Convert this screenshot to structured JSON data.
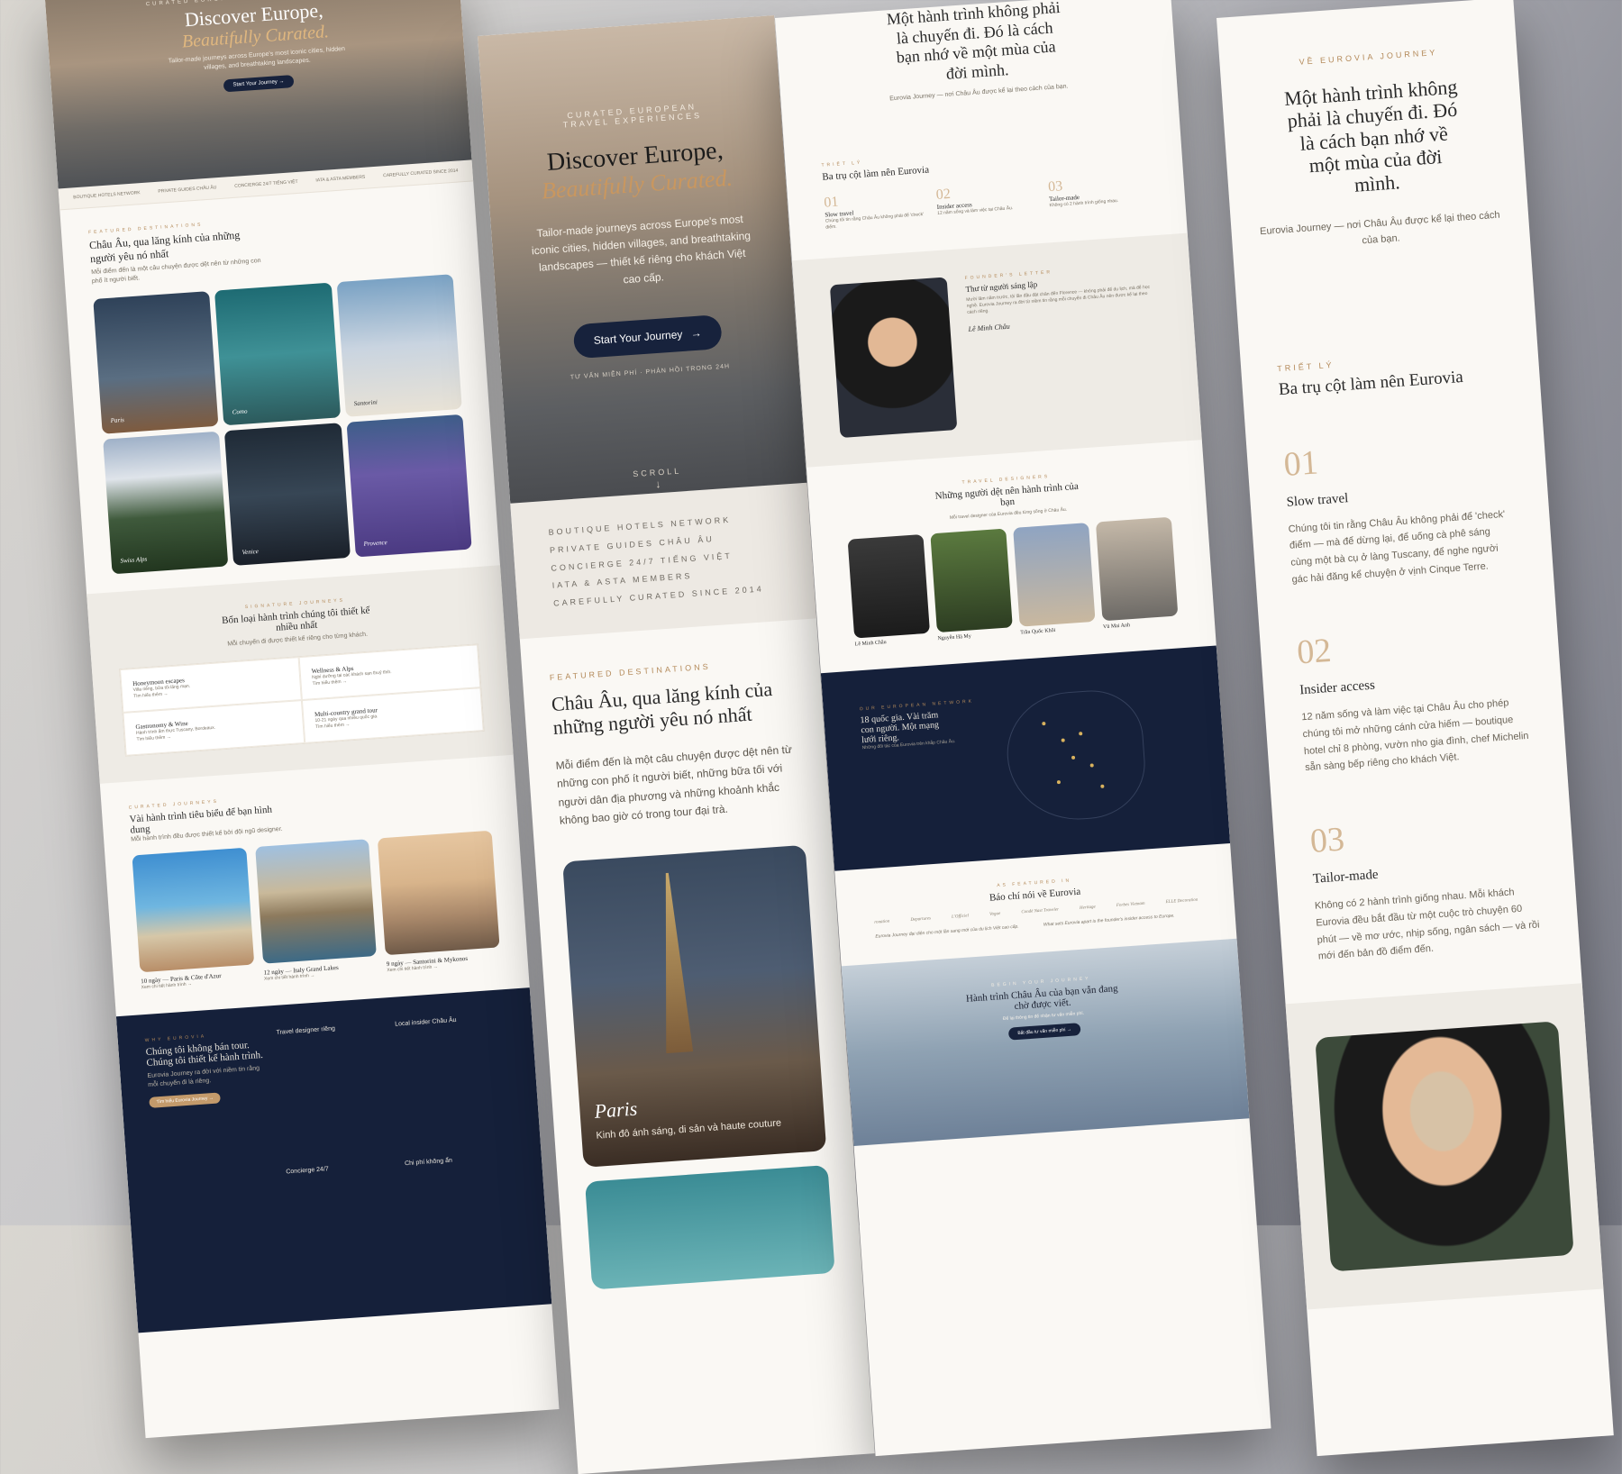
{
  "s1": {
    "hero_eyebrow": "CURATED EUROPEAN TRAVEL EXPERIENCES",
    "hero_title": "Discover Europe,",
    "hero_title_accent": "Beautifully Curated.",
    "hero_text": "Tailor-made journeys across Europe's most iconic cities, hidden villages, and breathtaking landscapes.",
    "hero_cta": "Start Your Journey →",
    "trust": [
      "BOUTIQUE HOTELS NETWORK",
      "PRIVATE GUIDES CHÂU ÂU",
      "CONCIERGE 24/7 TIẾNG VIỆT",
      "IATA & ASTA MEMBERS",
      "CAREFULLY CURATED SINCE 2014"
    ],
    "featured_eyebrow": "FEATURED DESTINATIONS",
    "featured_title": "Châu Âu, qua lăng kính của những người yêu nó nhất",
    "featured_text": "Mỗi điểm đến là một câu chuyện được dệt nên từ những con phố ít người biết.",
    "destinations": [
      "Paris",
      "Como",
      "Santorini",
      "Swiss Alps",
      "Venice",
      "Provence"
    ],
    "types_eyebrow": "SIGNATURE JOURNEYS",
    "types_title": "Bốn loại hành trình chúng tôi thiết kế nhiều nhất",
    "types_text": "Mỗi chuyến đi được thiết kế riêng cho từng khách.",
    "types": [
      {
        "title": "Honeymoon escapes",
        "desc": "Villa riêng, bữa tối lãng mạn.",
        "link": "Tìm hiểu thêm →"
      },
      {
        "title": "Wellness & Alps",
        "desc": "Nghỉ dưỡng tại các khách sạn thuỷ tĩnh.",
        "link": "Tìm hiểu thêm →"
      },
      {
        "title": "Gastronomy & Wine",
        "desc": "Hành trình ẩm thực Tuscany, Bordeaux.",
        "link": "Tìm hiểu thêm →"
      },
      {
        "title": "Multi-country grand tour",
        "desc": "10-21 ngày qua nhiều quốc gia.",
        "link": "Tìm hiểu thêm →"
      }
    ],
    "curated_eyebrow": "CURATED JOURNEYS",
    "curated_title": "Vài hành trình tiêu biểu để bạn hình dung",
    "curated_text": "Mỗi hành trình đều được thiết kế bởi đội ngũ designer.",
    "journeys": [
      {
        "title": "10 ngày — Paris & Côte d'Azur",
        "link": "Xem chi tiết hành trình →"
      },
      {
        "title": "12 ngày — Italy Grand Lakes",
        "link": "Xem chi tiết hành trình →"
      },
      {
        "title": "9 ngày — Santorini & Mykonos",
        "link": "Xem chi tiết hành trình →"
      }
    ],
    "why_eyebrow": "WHY EUROVIA",
    "why_title": "Chúng tôi không bán tour. Chúng tôi thiết kế hành trình.",
    "why_text": "Eurovia Journey ra đời với niềm tin rằng mỗi chuyến đi là riêng.",
    "why_cta": "Tìm hiểu Eurovia Journey →",
    "why_items": [
      "Travel designer riêng",
      "Local insider Châu Âu",
      "Concierge 24/7",
      "Chi phí không ẩn"
    ]
  },
  "s2": {
    "eyebrow": "CURATED EUROPEAN TRAVEL EXPERIENCES",
    "title": "Discover Europe,",
    "title_accent": "Beautifully Curated.",
    "text": "Tailor-made journeys across Europe's most iconic cities, hidden villages, and breathtaking landscapes — thiết kế riêng cho khách Việt cao cấp.",
    "cta": "Start Your Journey",
    "cta_arrow": "→",
    "note": "TƯ VẤN MIỄN PHÍ · PHẢN HỒI TRONG 24H",
    "scroll": "SCROLL",
    "scroll_arrow": "↓",
    "trust": [
      "BOUTIQUE HOTELS NETWORK",
      "PRIVATE GUIDES CHÂU ÂU",
      "CONCIERGE 24/7 TIẾNG VIỆT",
      "IATA & ASTA MEMBERS",
      "CAREFULLY CURATED SINCE 2014"
    ],
    "featured_eyebrow": "FEATURED DESTINATIONS",
    "featured_title": "Châu Âu, qua lăng kính của những người yêu nó nhất",
    "featured_text": "Mỗi điểm đến là một câu chuyện được dệt nên từ những con phố ít người biết, những bữa tối với người dân địa phương và những khoảnh khắc không bao giờ có trong tour đại trà.",
    "card_title": "Paris",
    "card_sub": "Kinh đô ánh sáng, di sản và haute couture"
  },
  "s3": {
    "quote": "Một hành trình không phải là chuyến đi. Đó là cách bạn nhớ về một mùa của đời mình.",
    "quote_sub": "Eurovia Journey — nơi Châu Âu được kể lại theo cách của bạn.",
    "pillars_eyebrow": "TRIẾT LÝ",
    "pillars_title": "Ba trụ cột làm nên Eurovia",
    "pillars": [
      {
        "num": "01",
        "title": "Slow travel",
        "desc": "Chúng tôi tin rằng Châu Âu không phải để 'check' điểm."
      },
      {
        "num": "02",
        "title": "Insider access",
        "desc": "12 năm sống và làm việc tại Châu Âu."
      },
      {
        "num": "03",
        "title": "Tailor-made",
        "desc": "Không có 2 hành trình giống nhau."
      }
    ],
    "letter_eyebrow": "FOUNDER'S LETTER",
    "letter_title": "Thư từ người sáng lập",
    "letter_text": "Mười lăm năm trước, tôi lần đầu đặt chân đến Florence — không phải để du lịch, mà để học nghề. Eurovia Journey ra đời từ niềm tin rằng mỗi chuyến đi Châu Âu nên được kể lại theo cách riêng.",
    "letter_sign": "Lê Minh Châu",
    "team_eyebrow": "TRAVEL DESIGNERS",
    "team_title": "Những người dệt nên hành trình của bạn",
    "team_text": "Mỗi travel designer của Eurovia đều từng sống ở Châu Âu.",
    "team": [
      "Lê Minh Châu",
      "Nguyễn Hà My",
      "Trần Quốc Khôi",
      "Vũ Mai Anh"
    ],
    "network_eyebrow": "OUR EUROPEAN NETWORK",
    "network_title": "18 quốc gia. Vài trăm con người. Một mạng lưới riêng.",
    "network_text": "Những đối tác của Eurovia trên khắp Châu Âu.",
    "press_eyebrow": "AS FEATURED IN",
    "press_title": "Báo chí nói về Eurovia",
    "press_logos": [
      "ronation",
      "Departures",
      "L'Officiel",
      "Vogue",
      "Condé Nast Traveler",
      "Heritage",
      "Forbes Vietnam",
      "ELLE Decoration"
    ],
    "press_quote1": "Eurovia Journey đại diện cho một lần sang mới của du lịch Việt cao cấp.",
    "press_quote2": "What sets Eurovia apart is the founder's insider access to Europe.",
    "cta_eyebrow": "BEGIN YOUR JOURNEY",
    "cta_title": "Hành trình Châu Âu của bạn vẫn đang chờ được viết.",
    "cta_text": "Để lại thông tin để nhận tư vấn miễn phí.",
    "cta_button": "Bắt đầu tư vấn miễn phí →"
  },
  "s4": {
    "eyebrow": "VỀ EUROVIA JOURNEY",
    "quote": "Một hành trình không phải là chuyến đi. Đó là cách bạn nhớ về một mùa của đời mình.",
    "quote_sub": "Eurovia Journey — nơi Châu Âu được kể lại theo cách của bạn.",
    "pillars_eyebrow": "TRIẾT LÝ",
    "pillars_title": "Ba trụ cột làm nên Eurovia",
    "pillars": [
      {
        "num": "01",
        "title": "Slow travel",
        "desc": "Chúng tôi tin rằng Châu Âu không phải để 'check' điểm — mà để dừng lại, để uống cà phê sáng cùng một bà cụ ở làng Tuscany, để nghe người gác hải đăng kể chuyện ở vịnh Cinque Terre."
      },
      {
        "num": "02",
        "title": "Insider access",
        "desc": "12 năm sống và làm việc tại Châu Âu cho phép chúng tôi mở những cánh cửa hiếm — boutique hotel chỉ 8 phòng, vườn nho gia đình, chef Michelin sẵn sàng bếp riêng cho khách Việt."
      },
      {
        "num": "03",
        "title": "Tailor-made",
        "desc": "Không có 2 hành trình giống nhau. Mỗi khách Eurovia đều bắt đầu từ một cuộc trò chuyện 60 phút — về mơ ước, nhịp sống, ngân sách — và rồi mới đến bản đồ điểm đến."
      }
    ]
  }
}
